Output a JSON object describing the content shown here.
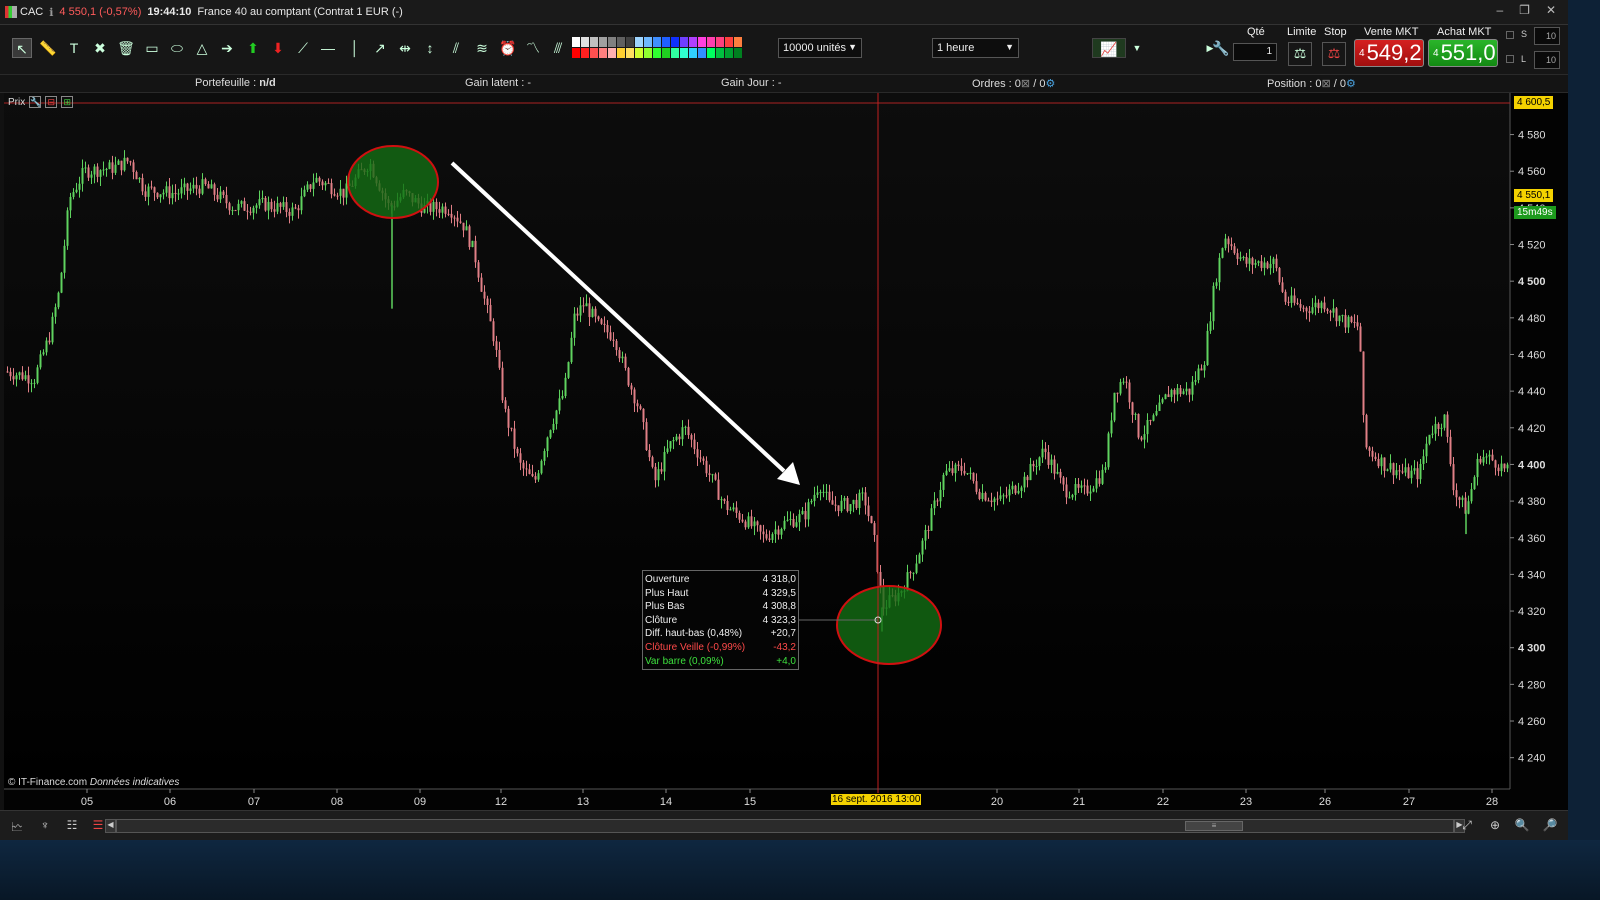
{
  "titlebar": {
    "symbol": "CAC",
    "price_change": "4 550,1 (-0,57%)",
    "time": "19:44:10",
    "description": "France 40 au comptant (Contrat 1 EUR (-)"
  },
  "toolbar": {
    "units_select": "10000 unités",
    "timeframe_select": "1 heure",
    "qty_label": "Qté",
    "qty_value": "1",
    "limit_label": "Limite",
    "stop_label": "Stop",
    "sell_label": "Vente MKT",
    "sell_prefix": "4",
    "sell_price": "549,2",
    "buy_label": "Achat MKT",
    "buy_prefix": "4",
    "buy_price": "551,0",
    "s_label": "S",
    "s_value": "10",
    "l_label": "L",
    "l_value": "10",
    "colors": [
      "#ffffff",
      "#e0e0e0",
      "#c0c0c0",
      "#a0a0a0",
      "#808080",
      "#606060",
      "#404040",
      "#9fd5ff",
      "#6fb8ff",
      "#3f8fff",
      "#1f5fff",
      "#0f2fff",
      "#6f3fff",
      "#af3fff",
      "#ff3fdf",
      "#ff3faf",
      "#ff3f7f",
      "#ff3f3f",
      "#ff7f3f",
      "#ff0000",
      "#ff2020",
      "#ff5050",
      "#ff8080",
      "#ffb0b0",
      "#ffd030",
      "#ffe060",
      "#d0ff30",
      "#90ff30",
      "#30ff30",
      "#20d020",
      "#30ffa0",
      "#30ffd0",
      "#30d0ff",
      "#3090ff",
      "#00ff60",
      "#00c040",
      "#00a030",
      "#008020"
    ]
  },
  "infobar": {
    "portefeuille_label": "Portefeuille :",
    "portefeuille_value": "n/d",
    "gain_latent": "Gain latent :  -",
    "gain_jour": "Gain Jour :  -",
    "ordres_label": "Ordres :",
    "ordres_a": "0",
    "ordres_b": "0",
    "position_label": "Position :",
    "position_a": "0",
    "position_b": "0"
  },
  "chart": {
    "panel_label": "Prix",
    "copyright": "© IT-Finance.com",
    "copyright_note": "Données indicatives",
    "top_tag": "4 600,5",
    "price_tag": "4 550,1",
    "countdown_tag": "15m49s",
    "crosshair_date": "16 sept. 2016 13:00",
    "x_labels": [
      "05",
      "06",
      "07",
      "08",
      "09",
      "12",
      "13",
      "14",
      "15",
      "20",
      "21",
      "22",
      "23",
      "26",
      "27",
      "28"
    ],
    "y_labels": [
      {
        "v": 4580,
        "t": "4 580",
        "bold": false
      },
      {
        "v": 4560,
        "t": "4 560",
        "bold": false
      },
      {
        "v": 4540,
        "t": "4 540",
        "bold": false
      },
      {
        "v": 4520,
        "t": "4 520",
        "bold": false
      },
      {
        "v": 4500,
        "t": "4 500",
        "bold": true
      },
      {
        "v": 4480,
        "t": "4 480",
        "bold": false
      },
      {
        "v": 4460,
        "t": "4 460",
        "bold": false
      },
      {
        "v": 4440,
        "t": "4 440",
        "bold": false
      },
      {
        "v": 4420,
        "t": "4 420",
        "bold": false
      },
      {
        "v": 4400,
        "t": "4 400",
        "bold": true
      },
      {
        "v": 4380,
        "t": "4 380",
        "bold": false
      },
      {
        "v": 4360,
        "t": "4 360",
        "bold": false
      },
      {
        "v": 4340,
        "t": "4 340",
        "bold": false
      },
      {
        "v": 4320,
        "t": "4 320",
        "bold": false
      },
      {
        "v": 4300,
        "t": "4 300",
        "bold": true
      },
      {
        "v": 4280,
        "t": "4 280",
        "bold": false
      },
      {
        "v": 4260,
        "t": "4 260",
        "bold": false
      },
      {
        "v": 4240,
        "t": "4 240",
        "bold": false
      }
    ]
  },
  "tooltip": {
    "rows": [
      {
        "label": "Ouverture",
        "value": "4 318,0",
        "kind": "normal"
      },
      {
        "label": "Plus Haut",
        "value": "4 329,5",
        "kind": "normal"
      },
      {
        "label": "Plus Bas",
        "value": "4 308,8",
        "kind": "normal"
      },
      {
        "label": "Clôture",
        "value": "4 323,3",
        "kind": "normal"
      },
      {
        "label": "Diff. haut-bas (0,48%)",
        "value": "+20,7",
        "kind": "normal"
      },
      {
        "label": "Clôture Veille (-0,99%)",
        "value": "-43,2",
        "kind": "neg"
      },
      {
        "label": "Var barre (0,09%)",
        "value": "+4,0",
        "kind": "pos"
      }
    ]
  },
  "chart_data": {
    "type": "candlestick",
    "ylim": [
      4230,
      4600.5
    ],
    "path": [
      [
        0,
        4451
      ],
      [
        30,
        4447
      ],
      [
        45,
        4470
      ],
      [
        55,
        4495
      ],
      [
        65,
        4545
      ],
      [
        80,
        4560
      ],
      [
        110,
        4562
      ],
      [
        125,
        4566
      ],
      [
        140,
        4550
      ],
      [
        170,
        4548
      ],
      [
        200,
        4552
      ],
      [
        230,
        4540
      ],
      [
        260,
        4542
      ],
      [
        290,
        4538
      ],
      [
        310,
        4556
      ],
      [
        340,
        4548
      ],
      [
        365,
        4565
      ],
      [
        385,
        4540
      ],
      [
        400,
        4548
      ],
      [
        420,
        4540
      ],
      [
        445,
        4540
      ],
      [
        460,
        4530
      ],
      [
        470,
        4515
      ],
      [
        480,
        4490
      ],
      [
        490,
        4468
      ],
      [
        500,
        4430
      ],
      [
        515,
        4400
      ],
      [
        530,
        4390
      ],
      [
        545,
        4420
      ],
      [
        560,
        4440
      ],
      [
        570,
        4480
      ],
      [
        580,
        4488
      ],
      [
        595,
        4475
      ],
      [
        610,
        4470
      ],
      [
        620,
        4452
      ],
      [
        635,
        4430
      ],
      [
        650,
        4390
      ],
      [
        665,
        4410
      ],
      [
        680,
        4420
      ],
      [
        700,
        4400
      ],
      [
        720,
        4378
      ],
      [
        740,
        4370
      ],
      [
        760,
        4360
      ],
      [
        780,
        4368
      ],
      [
        800,
        4372
      ],
      [
        815,
        4390
      ],
      [
        825,
        4378
      ],
      [
        845,
        4378
      ],
      [
        860,
        4382
      ],
      [
        870,
        4358
      ],
      [
        878,
        4322
      ],
      [
        895,
        4330
      ],
      [
        910,
        4345
      ],
      [
        920,
        4360
      ],
      [
        940,
        4395
      ],
      [
        960,
        4398
      ],
      [
        975,
        4385
      ],
      [
        995,
        4380
      ],
      [
        1020,
        4392
      ],
      [
        1040,
        4408
      ],
      [
        1060,
        4386
      ],
      [
        1080,
        4385
      ],
      [
        1100,
        4396
      ],
      [
        1110,
        4440
      ],
      [
        1120,
        4448
      ],
      [
        1135,
        4415
      ],
      [
        1150,
        4425
      ],
      [
        1165,
        4440
      ],
      [
        1185,
        4440
      ],
      [
        1200,
        4458
      ],
      [
        1210,
        4498
      ],
      [
        1220,
        4525
      ],
      [
        1240,
        4510
      ],
      [
        1270,
        4510
      ],
      [
        1280,
        4490
      ],
      [
        1300,
        4485
      ],
      [
        1320,
        4488
      ],
      [
        1340,
        4478
      ],
      [
        1355,
        4475
      ],
      [
        1360,
        4410
      ],
      [
        1380,
        4400
      ],
      [
        1400,
        4395
      ],
      [
        1415,
        4395
      ],
      [
        1425,
        4418
      ],
      [
        1440,
        4425
      ],
      [
        1450,
        4385
      ],
      [
        1462,
        4375
      ],
      [
        1475,
        4405
      ],
      [
        1490,
        4402
      ],
      [
        1505,
        4395
      ]
    ],
    "spikes": [
      {
        "x": 388,
        "low": 4485
      },
      {
        "x": 878,
        "low": 4308.8
      },
      {
        "x": 1462,
        "low": 4362
      }
    ]
  }
}
